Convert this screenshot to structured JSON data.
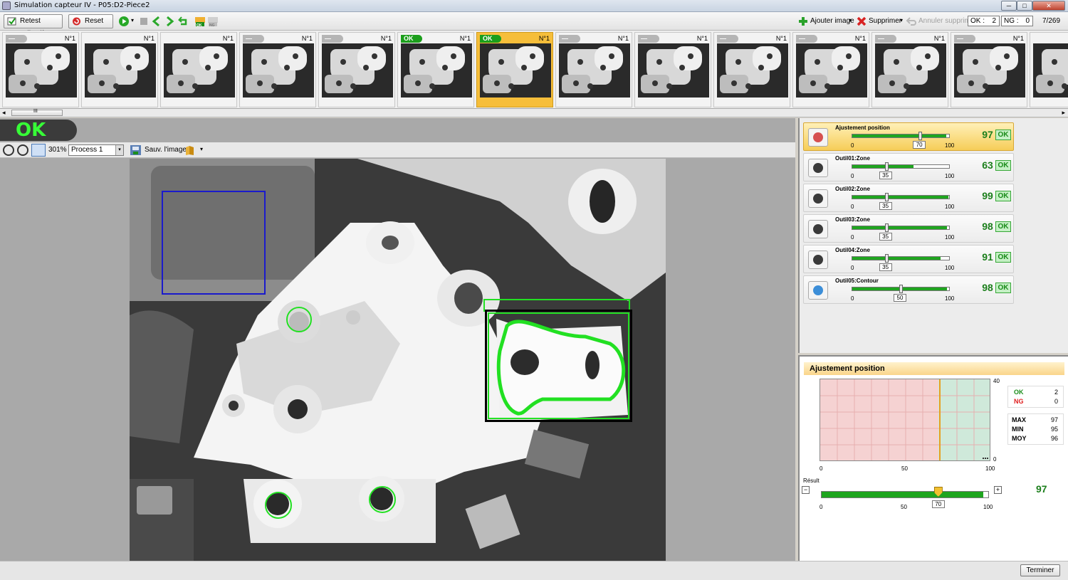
{
  "window": {
    "title": "Simulation capteur IV - P05:D2-Piece2",
    "min": "─",
    "max": "□",
    "close": "✕"
  },
  "toolbar": {
    "retest_label": "Retest collectif",
    "reset_label": "Reset",
    "add_image_label": "Ajouter image",
    "delete_label": "Supprimer",
    "cancel_delete_label": "Annuler supprimer",
    "ok_label": "OK :",
    "ok_count": "2",
    "ng_label": "NG :",
    "ng_count": "0",
    "image_index": "7/269",
    "ok_small": "OK",
    "ng_small": "NG"
  },
  "thumbnails": [
    {
      "num": "N°1",
      "tag": "—"
    },
    {
      "num": "N°1",
      "tag": ""
    },
    {
      "num": "N°1",
      "tag": ""
    },
    {
      "num": "N°1",
      "tag": "—"
    },
    {
      "num": "N°1",
      "tag": "—"
    },
    {
      "num": "N°1",
      "tag": "OK"
    },
    {
      "num": "N°1",
      "tag": "OK"
    },
    {
      "num": "N°1",
      "tag": "—"
    },
    {
      "num": "N°1",
      "tag": "—"
    },
    {
      "num": "N°1",
      "tag": "—"
    },
    {
      "num": "N°1",
      "tag": "—"
    },
    {
      "num": "N°1",
      "tag": "—"
    },
    {
      "num": "N°1",
      "tag": "—"
    },
    {
      "num": "N°1",
      "tag": ""
    }
  ],
  "selected_thumbnail_index": 6,
  "scrollbar": {
    "grip": "III",
    "left_arrow": "◂",
    "right_arrow": "▸"
  },
  "result": {
    "status": "OK"
  },
  "image_toolbar": {
    "zoom": "301%",
    "process": "Process 1",
    "save_label": "Sauv. l'image",
    "dropdown": "▾"
  },
  "tools": [
    {
      "name": "Ajustement position",
      "score": "97",
      "status": "OK",
      "threshold": "70",
      "min": "0",
      "max": "100",
      "value": 97,
      "icon": "position-adjust-icon"
    },
    {
      "name": "Outil01:Zone",
      "score": "63",
      "status": "OK",
      "threshold": "35",
      "min": "0",
      "max": "100",
      "value": 63,
      "icon": "zone-tool-icon"
    },
    {
      "name": "Outil02:Zone",
      "score": "99",
      "status": "OK",
      "threshold": "35",
      "min": "0",
      "max": "100",
      "value": 99,
      "icon": "zone-tool-icon"
    },
    {
      "name": "Outil03:Zone",
      "score": "98",
      "status": "OK",
      "threshold": "35",
      "min": "0",
      "max": "100",
      "value": 98,
      "icon": "zone-tool-icon"
    },
    {
      "name": "Outil04:Zone",
      "score": "91",
      "status": "OK",
      "threshold": "35",
      "min": "0",
      "max": "100",
      "value": 91,
      "icon": "zone-tool-icon"
    },
    {
      "name": "Outil05:Contour",
      "score": "98",
      "status": "OK",
      "threshold": "50",
      "min": "0",
      "max": "100",
      "value": 98,
      "icon": "contour-tool-icon"
    }
  ],
  "detail": {
    "title": "Ajustement position",
    "y_max": "40",
    "y_min": "0",
    "x_ticks": [
      "0",
      "50",
      "100"
    ],
    "threshold": 70,
    "ok_label": "OK",
    "ok_value": "2",
    "ng_label": "NG",
    "ng_value": "0",
    "max_label": "MAX",
    "max_value": "97",
    "min_label": "MIN",
    "min_value": "95",
    "moy_label": "MOY",
    "moy_value": "96",
    "result_label": "Résult",
    "result_value": "97",
    "slider_ticks": [
      "0",
      "50",
      "100"
    ],
    "slider_threshold": "70",
    "minus": "−",
    "plus": "+"
  },
  "colors": {
    "ok_green": "#1fa51f",
    "ng_red": "#e02020",
    "selection": "#f6be3a",
    "roi_blue": "#1a1acc",
    "roi_green": "#22e022"
  },
  "footer": {
    "finish_label": "Terminer"
  }
}
